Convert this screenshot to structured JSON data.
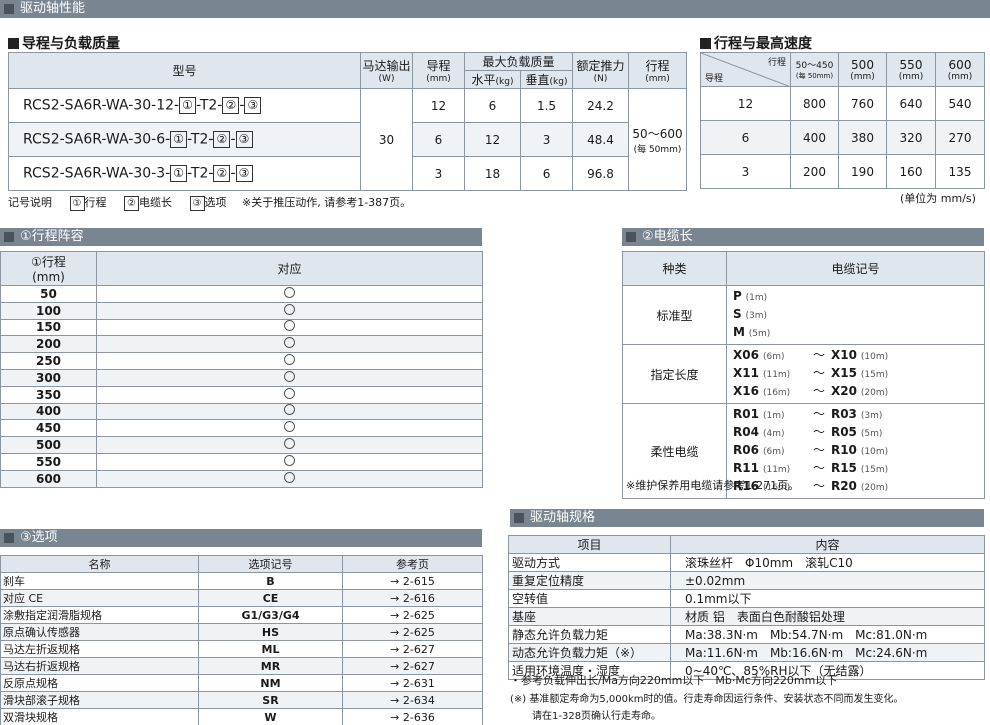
{
  "section_main": "驱动轴性能",
  "lead_title": "导程与负载质量",
  "speed_title": "行程与最高速度",
  "lead_table": {
    "h_model": "型号",
    "h_motor": "马达输出",
    "h_motor_unit": "(W)",
    "h_lead": "导程",
    "h_lead_unit": "(mm)",
    "h_payload": "最大负载质量",
    "h_horiz": "水平",
    "h_vert": "垂直",
    "h_kg": "(kg)",
    "h_thrust": "额定推力",
    "h_thrust_unit": "(N)",
    "h_stroke": "行程",
    "h_stroke_unit": "(mm)",
    "rows": [
      {
        "model": "RCS2-SA6R-WA-30-12-",
        "lead": "12",
        "horiz": "6",
        "vert": "1.5",
        "thrust": "24.2"
      },
      {
        "model": "RCS2-SA6R-WA-30-6-",
        "lead": "6",
        "horiz": "12",
        "vert": "3",
        "thrust": "48.4"
      },
      {
        "model": "RCS2-SA6R-WA-30-3-",
        "lead": "3",
        "horiz": "18",
        "vert": "6",
        "thrust": "96.8"
      }
    ],
    "box1": "①",
    "t2": "-T2-",
    "box2": "②",
    "dash": "-",
    "box3": "③",
    "motor": "30",
    "stroke": "50～600",
    "stroke_sub": "(每 50mm)"
  },
  "speed_table": {
    "h_stroke": "行程",
    "h_lead": "导程",
    "cols": [
      {
        "v": "50～450",
        "sub": "(每 50mm)"
      },
      {
        "v": "500",
        "sub": ""
      },
      {
        "v": "550",
        "sub": "(mm)"
      },
      {
        "v": "600",
        "sub": "(mm)"
      }
    ],
    "unit_500": "(mm)",
    "rows": [
      [
        "12",
        "800",
        "760",
        "640",
        "540"
      ],
      [
        "6",
        "400",
        "380",
        "320",
        "270"
      ],
      [
        "3",
        "200",
        "190",
        "160",
        "135"
      ]
    ],
    "unit_note": "(单位为 mm/s)"
  },
  "legend": {
    "label": "记号说明",
    "b1": "①",
    "t1": "行程",
    "b2": "②",
    "t2": "电缆长",
    "b3": "③",
    "t3": "选项",
    "note": "※关于推压动作, 请参考1-387页。"
  },
  "stroke_section": {
    "title": "①行程阵容",
    "h1": "①行程",
    "h1b": "(mm)",
    "h2": "对应",
    "rows": [
      "50",
      "100",
      "150",
      "200",
      "250",
      "300",
      "350",
      "400",
      "450",
      "500",
      "550",
      "600"
    ]
  },
  "cable_section": {
    "title": "②电缆长",
    "h_type": "种类",
    "h_code": "电缆记号",
    "groups": [
      {
        "type": "标准型",
        "rows": [
          [
            "P",
            "(1m)"
          ],
          [
            "S",
            "(3m)"
          ],
          [
            "M",
            "(5m)"
          ]
        ]
      },
      {
        "type": "指定长度",
        "rows": [
          [
            "X06",
            "(6m)",
            "X10",
            "(10m)"
          ],
          [
            "X11",
            "(11m)",
            "X15",
            "(15m)"
          ],
          [
            "X16",
            "(16m)",
            "X20",
            "(20m)"
          ]
        ]
      },
      {
        "type": "柔性电缆",
        "rows": [
          [
            "R01",
            "(1m)",
            "R03",
            "(3m)"
          ],
          [
            "R04",
            "(4m)",
            "R05",
            "(5m)"
          ],
          [
            "R06",
            "(6m)",
            "R10",
            "(10m)"
          ],
          [
            "R11",
            "(11m)",
            "R15",
            "(15m)"
          ],
          [
            "R16",
            "(16m)",
            "R20",
            "(20m)"
          ]
        ]
      }
    ],
    "tilde": "～",
    "note": "※维护保养用电缆请参考1-271页。"
  },
  "options_section": {
    "title": "③选项",
    "h_name": "名称",
    "h_code": "选项记号",
    "h_ref": "参考页",
    "rows": [
      [
        "刹车",
        "B",
        "→ 2-615"
      ],
      [
        "对应 CE",
        "CE",
        "→ 2-616"
      ],
      [
        "涂敷指定润滑脂规格",
        "G1/G3/G4",
        "→ 2-625"
      ],
      [
        "原点确认传感器",
        "HS",
        "→ 2-625"
      ],
      [
        "马达左折返规格",
        "ML",
        "→ 2-627"
      ],
      [
        "马达右折返规格",
        "MR",
        "→ 2-627"
      ],
      [
        "反原点规格",
        "NM",
        "→ 2-631"
      ],
      [
        "滑块部滚子规格",
        "SR",
        "→ 2-634"
      ],
      [
        "双滑块规格",
        "W",
        "→ 2-636"
      ]
    ]
  },
  "spec_section": {
    "title": "驱动轴规格",
    "h_item": "项目",
    "h_content": "内容",
    "rows": [
      [
        "驱动方式",
        "滚珠丝杆　Φ10mm　滚轧C10"
      ],
      [
        "重复定位精度",
        "±0.02mm"
      ],
      [
        "空转值",
        "0.1mm以下"
      ],
      [
        "基座",
        "材质 铝　表面白色耐酸铝处理"
      ],
      [
        "静态允许负载力矩",
        "Ma:38.3N·m　Mb:54.7N·m　Mc:81.0N·m"
      ],
      [
        "动态允许负载力矩（※）",
        "Ma:11.6N·m　Mb:16.6N·m　Mc:24.6N·m"
      ],
      [
        "适用环境温度・湿度",
        "0~40℃、85%RH以下（无结露）"
      ]
    ],
    "note1": "・参考负载伸出长/Ma方向220mm以下　Mb·Mc方向220mm以下",
    "note2": "(※) 基准额定寿命为5,000km时的值。行走寿命因运行条件、安装状态不同而发生变化。",
    "note3": "请在1-328页确认行走寿命。"
  }
}
